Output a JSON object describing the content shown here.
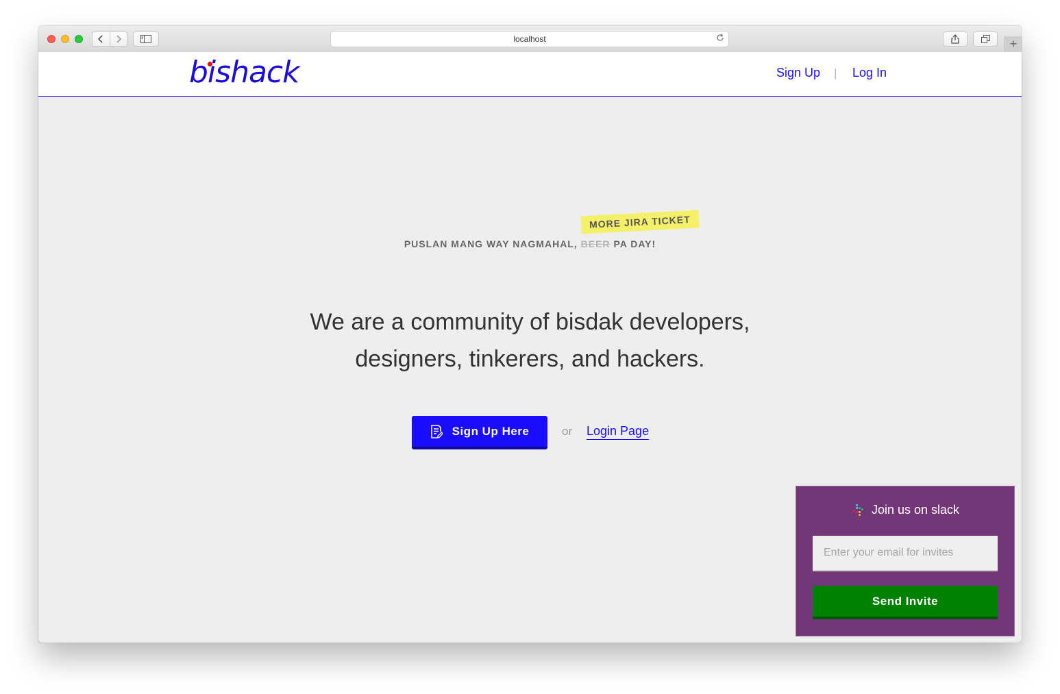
{
  "browser": {
    "address": "localhost",
    "reload_icon": "reload-icon",
    "back_icon": "chevron-left-icon",
    "forward_icon": "chevron-right-icon",
    "new_tab": "+"
  },
  "header": {
    "logo_text": "bishack",
    "signup_label": "Sign Up",
    "separator": "|",
    "login_label": "Log In"
  },
  "hero": {
    "tagline_prefix": "PUSLAN MANG WAY NAGMAHAL,",
    "tagline_struck": "BEER",
    "tagline_suffix": "PA DAY!",
    "sticker": "MORE JIRA TICKET",
    "headline_line1": "We are a community of bisdak developers,",
    "headline_line2": "designers, tinkerers, and hackers.",
    "cta_label": "Sign Up Here",
    "or_text": "or",
    "login_link": "Login Page"
  },
  "slack": {
    "title": "Join us on slack",
    "email_placeholder": "Enter your email for invites",
    "email_value": "",
    "button_label": "Send Invite"
  },
  "colors": {
    "brand_blue": "#1a0dff",
    "slack_purple": "#733777",
    "invite_green": "#008000",
    "sticker_yellow": "#f4f06a"
  }
}
